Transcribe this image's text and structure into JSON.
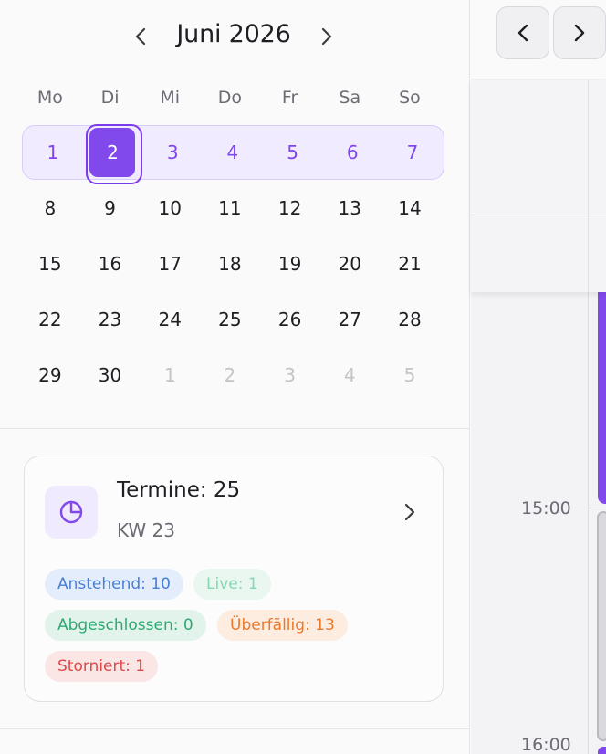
{
  "calendar": {
    "month_title": "Juni 2026",
    "weekdays": [
      "Mo",
      "Di",
      "Mi",
      "Do",
      "Fr",
      "Sa",
      "So"
    ],
    "weeks": [
      [
        "1",
        "2",
        "3",
        "4",
        "5",
        "6",
        "7"
      ],
      [
        "8",
        "9",
        "10",
        "11",
        "12",
        "13",
        "14"
      ],
      [
        "15",
        "16",
        "17",
        "18",
        "19",
        "20",
        "21"
      ],
      [
        "22",
        "23",
        "24",
        "25",
        "26",
        "27",
        "28"
      ],
      [
        "29",
        "30",
        "1",
        "2",
        "3",
        "4",
        "5"
      ]
    ],
    "selected_day": "2",
    "accent_color": "#8148ec"
  },
  "summary_card": {
    "title": "Termine: 25",
    "subtitle": "KW 23",
    "icon": "pie-chart-icon",
    "badges": [
      {
        "label": "Anstehend: 10",
        "bg": "#e3edfb",
        "fg": "#4a7fd6"
      },
      {
        "label": "Live: 1",
        "bg": "#eaf7f1",
        "fg": "#86d6b4"
      },
      {
        "label": "Abgeschlossen: 0",
        "bg": "#e1f3ea",
        "fg": "#2ea972"
      },
      {
        "label": "Überfällig: 13",
        "bg": "#fdece0",
        "fg": "#ea7a2c"
      },
      {
        "label": "Storniert: 1",
        "bg": "#fbe6e6",
        "fg": "#e04848"
      }
    ]
  },
  "schedule": {
    "times": [
      "15:00",
      "16:00"
    ]
  }
}
